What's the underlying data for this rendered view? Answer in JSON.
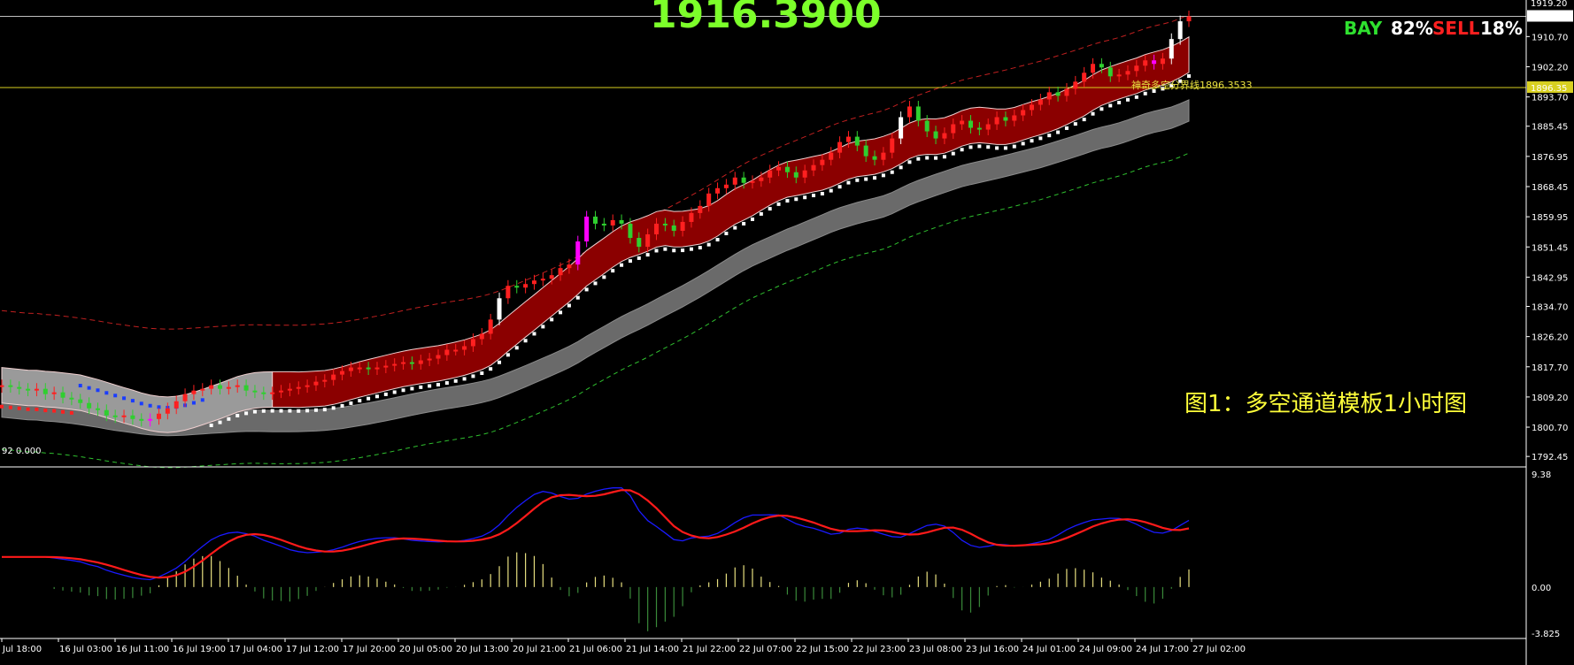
{
  "header": {
    "price": "1916.3900",
    "buy_label": "BAY",
    "buy_pct": "82%",
    "sell_label": "SELL",
    "sell_pct": "18%"
  },
  "caption": "图1：多空通道模板1小时图",
  "level_label": "神奇多空分界线1896.3533",
  "indicator_header": "92 0.000",
  "colors": {
    "up_candle": "#ff2020",
    "down_candle": "#2fcf2f",
    "channel_fill": "#8b0000",
    "neutral_fill": "#9a9a9a",
    "blue_dots": "#1a3cff",
    "white_dots": "#ffffff",
    "magenta": "#ff00ff",
    "macd_main": "#1a1aff",
    "macd_signal": "#ff1a1a",
    "histogram": "#e8e080",
    "level_line": "#d8d020"
  },
  "chart_data": {
    "type": "candlestick",
    "price_axis": {
      "ticks": [
        "1792.45",
        "1800.70",
        "1809.20",
        "1817.70",
        "1826.20",
        "1834.70",
        "1842.95",
        "1851.45",
        "1859.95",
        "1868.45",
        "1876.95",
        "1885.45",
        "1893.70",
        "1902.20",
        "1910.70"
      ],
      "current_price_label": "1916.39",
      "level_price_label": "1896.35",
      "top_label": "1919.20",
      "range": [
        1790.0,
        1920.0
      ]
    },
    "indicator_axis": {
      "ticks": [
        "9.38",
        "0.00",
        "-3.825"
      ],
      "range": [
        -3.825,
        9.38
      ]
    },
    "x_labels": [
      "Jul 18:00",
      "16 Jul 03:00",
      "16 Jul 11:00",
      "16 Jul 19:00",
      "17 Jul 04:00",
      "17 Jul 12:00",
      "17 Jul 20:00",
      "20 Jul 05:00",
      "20 Jul 13:00",
      "20 Jul 21:00",
      "21 Jul 06:00",
      "21 Jul 14:00",
      "21 Jul 22:00",
      "22 Jul 07:00",
      "22 Jul 15:00",
      "22 Jul 23:00",
      "23 Jul 08:00",
      "23 Jul 16:00",
      "24 Jul 01:00",
      "24 Jul 09:00",
      "24 Jul 17:00",
      "27 Jul 02:00"
    ],
    "close_path": [
      1812.5,
      1812.0,
      1811.5,
      1811.0,
      1811.5,
      1810.0,
      1810.5,
      1809.0,
      1808.5,
      1807.5,
      1806.0,
      1805.5,
      1804.0,
      1803.5,
      1804.0,
      1803.0,
      1802.5,
      1803.0,
      1804.5,
      1806.0,
      1808.0,
      1810.0,
      1811.0,
      1811.5,
      1812.5,
      1811.5,
      1812.0,
      1812.5,
      1811.0,
      1810.5,
      1810.0,
      1810.5,
      1811.0,
      1811.5,
      1812.0,
      1812.5,
      1813.5,
      1814.0,
      1815.5,
      1816.5,
      1817.5,
      1817.5,
      1817.0,
      1817.5,
      1818.0,
      1818.5,
      1819.0,
      1818.5,
      1819.5,
      1820.0,
      1821.0,
      1822.5,
      1822.5,
      1823.5,
      1825.5,
      1827.0,
      1831.0,
      1837.0,
      1840.5,
      1840.0,
      1841.0,
      1842.0,
      1842.5,
      1843.5,
      1845.5,
      1846.5,
      1853.0,
      1860.0,
      1858.0,
      1857.5,
      1859.0,
      1858.0,
      1854.0,
      1851.5,
      1855.0,
      1858.0,
      1857.5,
      1856.0,
      1858.5,
      1861.0,
      1863.0,
      1866.5,
      1868.0,
      1869.0,
      1871.0,
      1869.5,
      1870.0,
      1871.0,
      1873.0,
      1874.0,
      1872.5,
      1871.0,
      1873.0,
      1874.5,
      1876.0,
      1878.0,
      1881.0,
      1882.5,
      1880.0,
      1877.0,
      1876.0,
      1878.0,
      1882.0,
      1888.0,
      1891.0,
      1887.0,
      1884.0,
      1882.0,
      1883.5,
      1886.0,
      1887.0,
      1885.0,
      1884.5,
      1886.0,
      1888.0,
      1887.0,
      1888.5,
      1890.0,
      1891.5,
      1893.0,
      1895.0,
      1894.0,
      1896.0,
      1898.0,
      1900.5,
      1903.0,
      1902.0,
      1899.5,
      1900.0,
      1901.0,
      1902.5,
      1904.0,
      1903.0,
      1904.5,
      1910.0,
      1915.0,
      1916.4
    ]
  }
}
